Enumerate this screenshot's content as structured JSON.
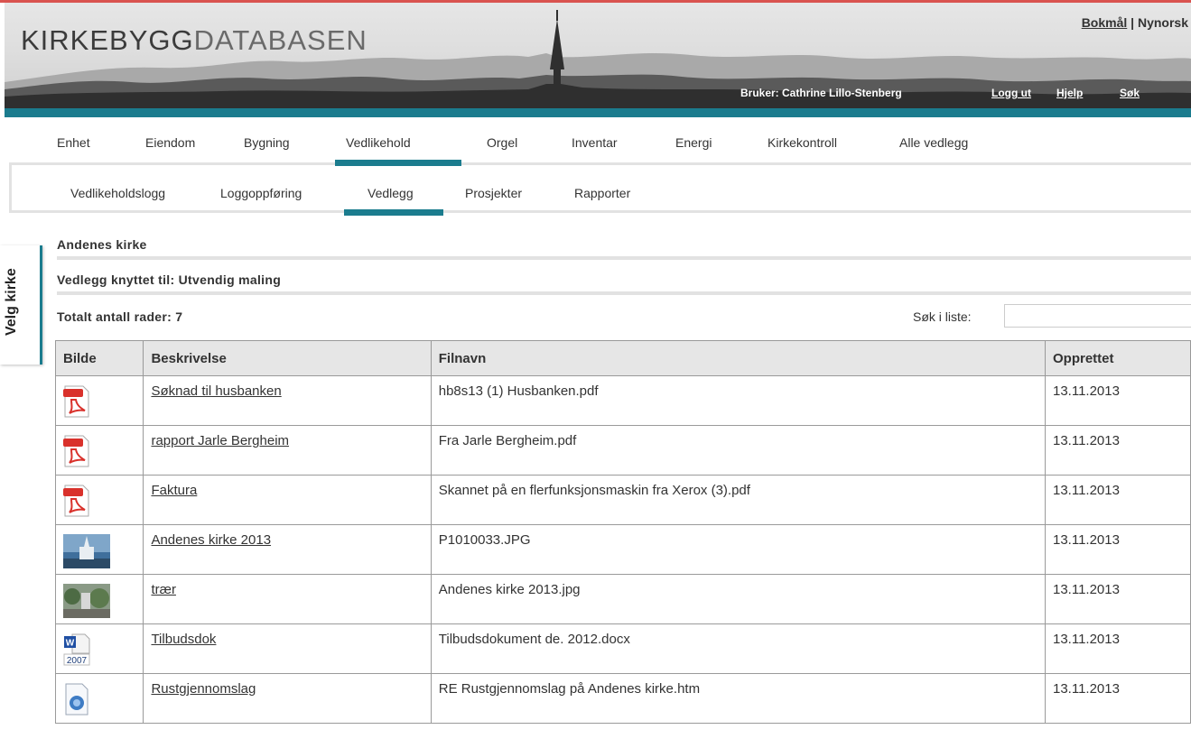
{
  "header": {
    "logo_bold": "KIRKEBYGG",
    "logo_light": "DATABASEN",
    "lang_bokmal": "Bokmål",
    "lang_sep": " | ",
    "lang_nynorsk": "Nynorsk",
    "user_label": "Bruker: Cathrine Lillo-Stenberg",
    "logout": "Logg ut",
    "help": "Hjelp",
    "search": "Søk"
  },
  "main_tabs": [
    "Enhet",
    "Eiendom",
    "Bygning",
    "Vedlikehold",
    "Orgel",
    "Inventar",
    "Energi",
    "Kirkekontroll",
    "Alle vedlegg"
  ],
  "main_tab_active": "Vedlikehold",
  "sub_tabs": [
    "Vedlikeholdslogg",
    "Loggoppføring",
    "Vedlegg",
    "Prosjekter",
    "Rapporter"
  ],
  "sub_tab_active": "Vedlegg",
  "side_tab": "Velg kirke",
  "content": {
    "church": "Andenes kirke",
    "linked_to": "Vedlegg knyttet til: Utvendig maling",
    "total_rows": "Totalt antall rader: 7",
    "search_label": "Søk i liste:",
    "search_value": ""
  },
  "table": {
    "headers": [
      "Bilde",
      "Beskrivelse",
      "Filnavn",
      "Opprettet"
    ],
    "rows": [
      {
        "icon": "pdf-icon",
        "description": "Søknad til husbanken",
        "filename": "hb8s13 (1) Husbanken.pdf",
        "created": "13.11.2013"
      },
      {
        "icon": "pdf-icon",
        "description": "rapport Jarle Bergheim",
        "filename": "Fra Jarle Bergheim.pdf",
        "created": "13.11.2013"
      },
      {
        "icon": "pdf-icon",
        "description": "Faktura",
        "filename": "Skannet på en flerfunksjonsmaskin fra Xerox (3).pdf",
        "created": "13.11.2013"
      },
      {
        "icon": "church-photo-thumbnail",
        "description": "Andenes kirke 2013",
        "filename": "P1010033.JPG",
        "created": "13.11.2013"
      },
      {
        "icon": "trees-photo-thumbnail",
        "description": "trær",
        "filename": "Andenes kirke 2013.jpg",
        "created": "13.11.2013"
      },
      {
        "icon": "word-2007-icon",
        "description": "Tilbudsdok",
        "filename": "Tilbudsdokument de. 2012.docx",
        "created": "13.11.2013"
      },
      {
        "icon": "web-page-icon",
        "description": "Rustgjennomslag",
        "filename": "RE Rustgjennomslag på Andenes kirke.htm",
        "created": "13.11.2013"
      }
    ]
  },
  "colors": {
    "accent": "#1b7c8e",
    "header_dark": "#2f2f2f",
    "rule_gray": "#e2e2e2"
  }
}
